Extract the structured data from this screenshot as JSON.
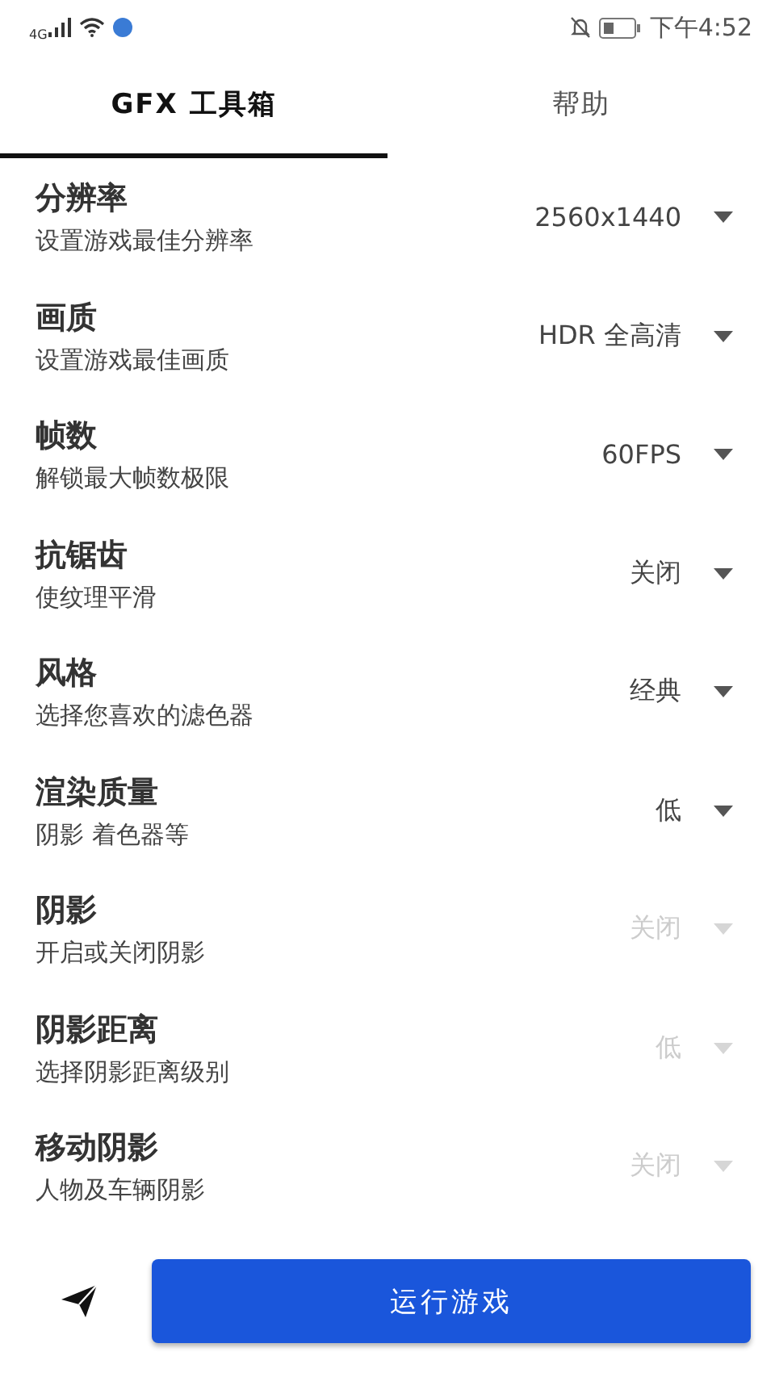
{
  "status_bar": {
    "network": "4G",
    "time": "下午4:52"
  },
  "tabs": [
    {
      "label": "GFX 工具箱",
      "selected": true
    },
    {
      "label": "帮助",
      "selected": false
    }
  ],
  "settings": [
    {
      "title": "分辨率",
      "subtitle": "设置游戏最佳分辨率",
      "value": "2560x1440",
      "disabled": false
    },
    {
      "title": "画质",
      "subtitle": "设置游戏最佳画质",
      "value": "HDR 全高清",
      "disabled": false
    },
    {
      "title": "帧数",
      "subtitle": "解锁最大帧数极限",
      "value": "60FPS",
      "disabled": false
    },
    {
      "title": "抗锯齿",
      "subtitle": "使纹理平滑",
      "value": "关闭",
      "disabled": false
    },
    {
      "title": "风格",
      "subtitle": "选择您喜欢的滤色器",
      "value": "经典",
      "disabled": false
    },
    {
      "title": "渲染质量",
      "subtitle": "阴影 着色器等",
      "value": "低",
      "disabled": false
    },
    {
      "title": "阴影",
      "subtitle": "开启或关闭阴影",
      "value": "关闭",
      "disabled": true
    },
    {
      "title": "阴影距离",
      "subtitle": "选择阴影距离级别",
      "value": "低",
      "disabled": true
    },
    {
      "title": "移动阴影",
      "subtitle": "人物及车辆阴影",
      "value": "关闭",
      "disabled": true
    }
  ],
  "run_button": "运行游戏"
}
